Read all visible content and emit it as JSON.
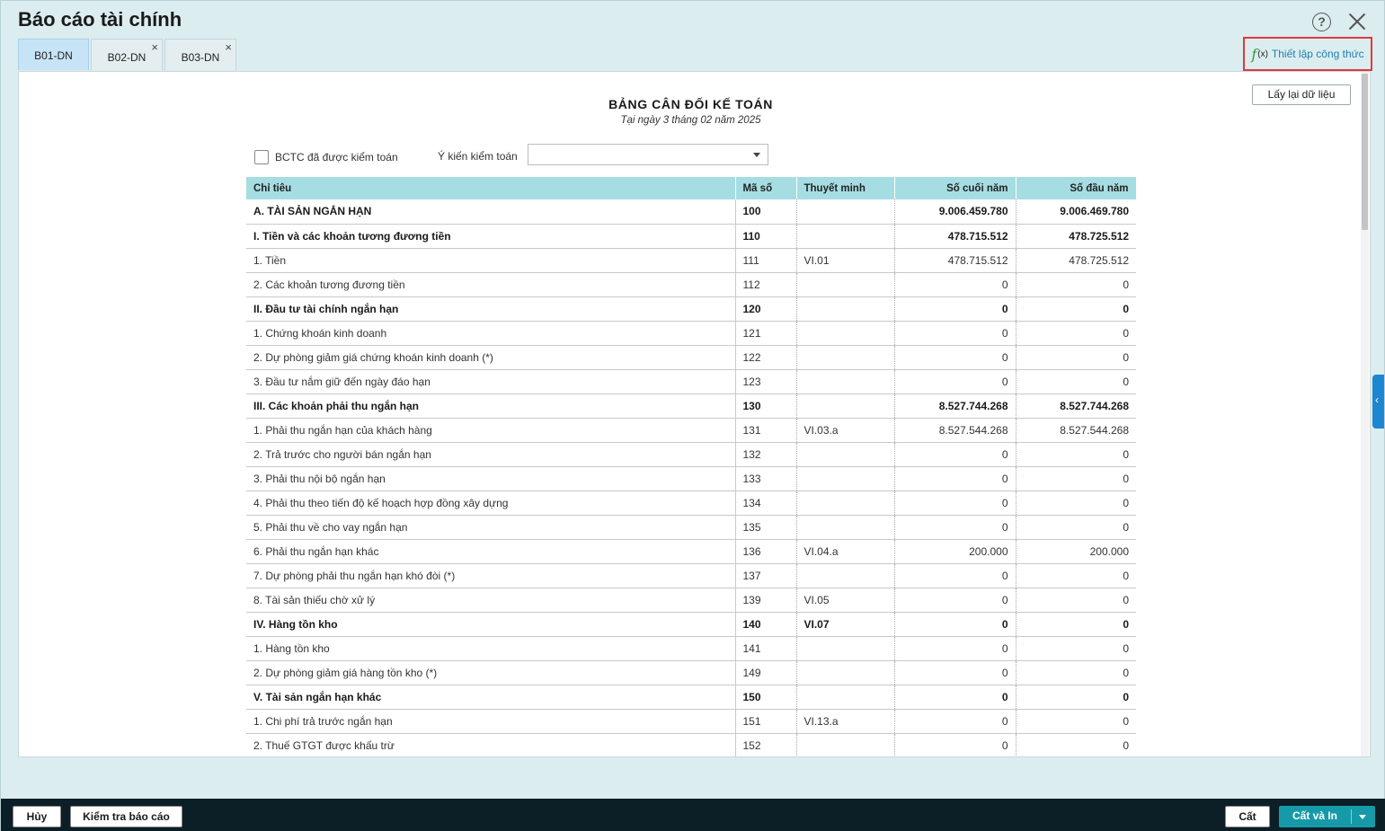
{
  "window": {
    "title": "Báo cáo tài chính",
    "help_glyph": "?"
  },
  "tabs": [
    {
      "label": "B01-DN",
      "active": true
    },
    {
      "label": "B02-DN",
      "active": false
    },
    {
      "label": "B03-DN",
      "active": false
    }
  ],
  "tab_close_glyph": "×",
  "toolbar": {
    "formula_icon": "f",
    "formula_icon_sub": "(x)",
    "formula_label": "Thiết lập công thức",
    "reload_label": "Lấy lại dữ liệu"
  },
  "report": {
    "title": "BẢNG CÂN ĐỐI KẾ TOÁN",
    "subtitle": "Tại ngày 3 tháng 02 năm 2025",
    "audited_label": "BCTC đã được kiểm toán",
    "opinion_label": "Ý kiến kiểm toán",
    "opinion_value": ""
  },
  "table": {
    "headers": [
      "Chỉ tiêu",
      "Mã số",
      "Thuyết minh",
      "Số cuối năm",
      "Số đầu năm"
    ],
    "rows": [
      {
        "name": "A. TÀI SẢN NGẮN HẠN",
        "code": "100",
        "note": "",
        "end": "9.006.459.780",
        "start": "9.006.469.780",
        "bold": true,
        "link": false
      },
      {
        "name": "I. Tiền và các khoản tương đương tiền",
        "code": "110",
        "note": "",
        "end": "478.715.512",
        "start": "478.725.512",
        "bold": true,
        "link": false
      },
      {
        "name": "1. Tiền",
        "code": "111",
        "note": "VI.01",
        "end": "478.715.512",
        "start": "478.725.512",
        "bold": false,
        "link": false
      },
      {
        "name": "2. Các khoản tương đương tiền",
        "code": "112",
        "note": "",
        "end": "0",
        "start": "0",
        "bold": false,
        "link": false
      },
      {
        "name": "II. Đầu tư tài chính ngắn hạn",
        "code": "120",
        "note": "",
        "end": "0",
        "start": "0",
        "bold": true,
        "link": false
      },
      {
        "name": "1. Chứng khoán kinh doanh",
        "code": "121",
        "note": "",
        "end": "0",
        "start": "0",
        "bold": false,
        "link": false
      },
      {
        "name": "2. Dự phòng giảm giá chứng khoán kinh doanh (*)",
        "code": "122",
        "note": "",
        "end": "0",
        "start": "0",
        "bold": false,
        "link": false
      },
      {
        "name": "3. Đầu tư nắm giữ đến ngày đáo hạn",
        "code": "123",
        "note": "",
        "end": "0",
        "start": "0",
        "bold": false,
        "link": false
      },
      {
        "name": "III. Các khoản phải thu ngắn hạn",
        "code": "130",
        "note": "",
        "end": "8.527.744.268",
        "start": "8.527.744.268",
        "bold": true,
        "link": false
      },
      {
        "name": "1. Phải thu ngắn hạn của khách hàng",
        "code": "131",
        "note": "VI.03.a",
        "end": "8.527.544.268",
        "start": "8.527.544.268",
        "bold": false,
        "link": true
      },
      {
        "name": "2. Trả trước cho người bán ngắn hạn",
        "code": "132",
        "note": "",
        "end": "0",
        "start": "0",
        "bold": false,
        "link": true
      },
      {
        "name": "3. Phải thu nội bộ ngắn hạn",
        "code": "133",
        "note": "",
        "end": "0",
        "start": "0",
        "bold": false,
        "link": false
      },
      {
        "name": "4. Phải thu theo tiến độ kế hoạch hợp đồng xây dựng",
        "code": "134",
        "note": "",
        "end": "0",
        "start": "0",
        "bold": false,
        "link": false
      },
      {
        "name": "5. Phải thu về cho vay ngắn hạn",
        "code": "135",
        "note": "",
        "end": "0",
        "start": "0",
        "bold": false,
        "link": false
      },
      {
        "name": "6. Phải thu ngắn hạn khác",
        "code": "136",
        "note": "VI.04.a",
        "end": "200.000",
        "start": "200.000",
        "bold": false,
        "link": true
      },
      {
        "name": "7. Dự phòng phải thu ngắn hạn khó đòi (*)",
        "code": "137",
        "note": "",
        "end": "0",
        "start": "0",
        "bold": false,
        "link": false
      },
      {
        "name": "8. Tài sản thiếu chờ xử lý",
        "code": "139",
        "note": "VI.05",
        "end": "0",
        "start": "0",
        "bold": false,
        "link": false
      },
      {
        "name": "IV. Hàng tồn kho",
        "code": "140",
        "note": "VI.07",
        "end": "0",
        "start": "0",
        "bold": true,
        "link": false
      },
      {
        "name": "1. Hàng tồn kho",
        "code": "141",
        "note": "",
        "end": "0",
        "start": "0",
        "bold": false,
        "link": false
      },
      {
        "name": "2. Dự phòng giảm giá hàng tồn kho (*)",
        "code": "149",
        "note": "",
        "end": "0",
        "start": "0",
        "bold": false,
        "link": false
      },
      {
        "name": "V. Tài sản ngắn hạn khác",
        "code": "150",
        "note": "",
        "end": "0",
        "start": "0",
        "bold": true,
        "link": false
      },
      {
        "name": "1. Chi phí trả trước ngắn hạn",
        "code": "151",
        "note": "VI.13.a",
        "end": "0",
        "start": "0",
        "bold": false,
        "link": false
      },
      {
        "name": "2. Thuế GTGT được khấu trừ",
        "code": "152",
        "note": "",
        "end": "0",
        "start": "0",
        "bold": false,
        "link": false
      }
    ]
  },
  "side_tab_glyph": "‹",
  "footer": {
    "cancel_label": "Hủy",
    "check_label": "Kiểm tra báo cáo",
    "save_label": "Cất",
    "save_print_label": "Cất và In"
  },
  "colors": {
    "header_bg": "#a5dde3",
    "link": "#2a6fa3",
    "accent": "#179aa8",
    "highlight_border": "#e0393e",
    "footer_bg": "#0c1e26"
  }
}
